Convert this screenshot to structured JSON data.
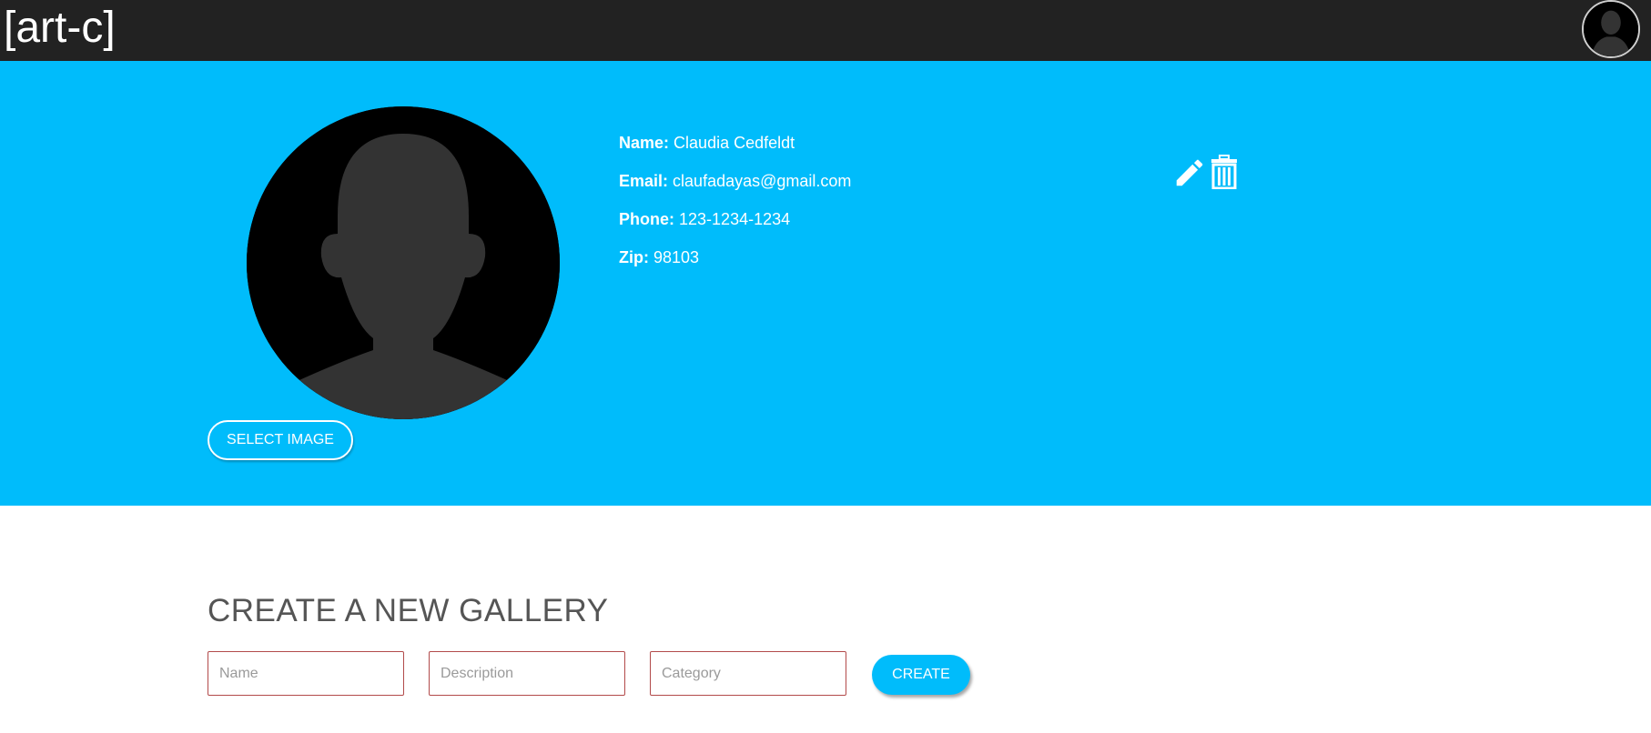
{
  "app": {
    "logo": "[art-c]"
  },
  "colors": {
    "topbar": "#222222",
    "accent": "#00bcfb",
    "field_border": "#b24a4a",
    "heading": "#555555"
  },
  "header": {
    "avatar_icon": "user-avatar-icon"
  },
  "profile": {
    "avatar_icon": "default-user-silhouette-icon",
    "select_image_label": "SELECT IMAGE",
    "name_label": "Name:",
    "name_value": "Claudia Cedfeldt",
    "email_label": "Email:",
    "email_value": "claufadayas@gmail.com",
    "phone_label": "Phone:",
    "phone_value": "123-1234-1234",
    "zip_label": "Zip:",
    "zip_value": "98103",
    "edit_icon": "pencil-icon",
    "delete_icon": "trash-icon"
  },
  "gallery_form": {
    "title": "CREATE A NEW GALLERY",
    "name_placeholder": "Name",
    "description_placeholder": "Description",
    "category_placeholder": "Category",
    "create_label": "CREATE"
  }
}
